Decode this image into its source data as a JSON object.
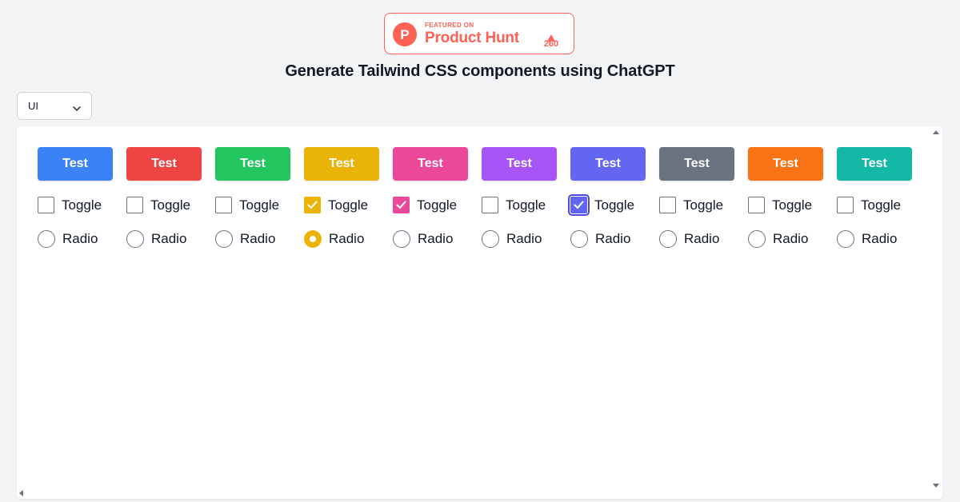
{
  "badge": {
    "featured_on": "FEATURED ON",
    "name": "Product Hunt",
    "logo_letter": "P",
    "votes": "260",
    "color": "#ff6154"
  },
  "page_title": "Generate Tailwind CSS components using ChatGPT",
  "framework_select": {
    "value": "UI",
    "icon": "chevron-down-icon"
  },
  "preview": {
    "columns": [
      {
        "button_label": "Test",
        "color": "#3b82f6",
        "toggle_label": "Toggle",
        "toggle_checked": false,
        "radio_label": "Radio",
        "radio_checked": false
      },
      {
        "button_label": "Test",
        "color": "#ef4444",
        "toggle_label": "Toggle",
        "toggle_checked": false,
        "radio_label": "Radio",
        "radio_checked": false
      },
      {
        "button_label": "Test",
        "color": "#22c55e",
        "toggle_label": "Toggle",
        "toggle_checked": false,
        "radio_label": "Radio",
        "radio_checked": false
      },
      {
        "button_label": "Test",
        "color": "#eab308",
        "toggle_label": "Toggle",
        "toggle_checked": true,
        "radio_label": "Radio",
        "radio_checked": true
      },
      {
        "button_label": "Test",
        "color": "#ec4899",
        "toggle_label": "Toggle",
        "toggle_checked": true,
        "radio_label": "Radio",
        "radio_checked": false
      },
      {
        "button_label": "Test",
        "color": "#a855f7",
        "toggle_label": "Toggle",
        "toggle_checked": false,
        "radio_label": "Radio",
        "radio_checked": false
      },
      {
        "button_label": "Test",
        "color": "#6366f1",
        "toggle_label": "Toggle",
        "toggle_checked": true,
        "toggle_focused": true,
        "radio_label": "Radio",
        "radio_checked": false
      },
      {
        "button_label": "Test",
        "color": "#6b7280",
        "toggle_label": "Toggle",
        "toggle_checked": false,
        "radio_label": "Radio",
        "radio_checked": false
      },
      {
        "button_label": "Test",
        "color": "#f97316",
        "toggle_label": "Toggle",
        "toggle_checked": false,
        "radio_label": "Radio",
        "radio_checked": false
      },
      {
        "button_label": "Test",
        "color": "#14b8a6",
        "toggle_label": "Toggle",
        "toggle_checked": false,
        "radio_label": "Radio",
        "radio_checked": false
      }
    ]
  }
}
